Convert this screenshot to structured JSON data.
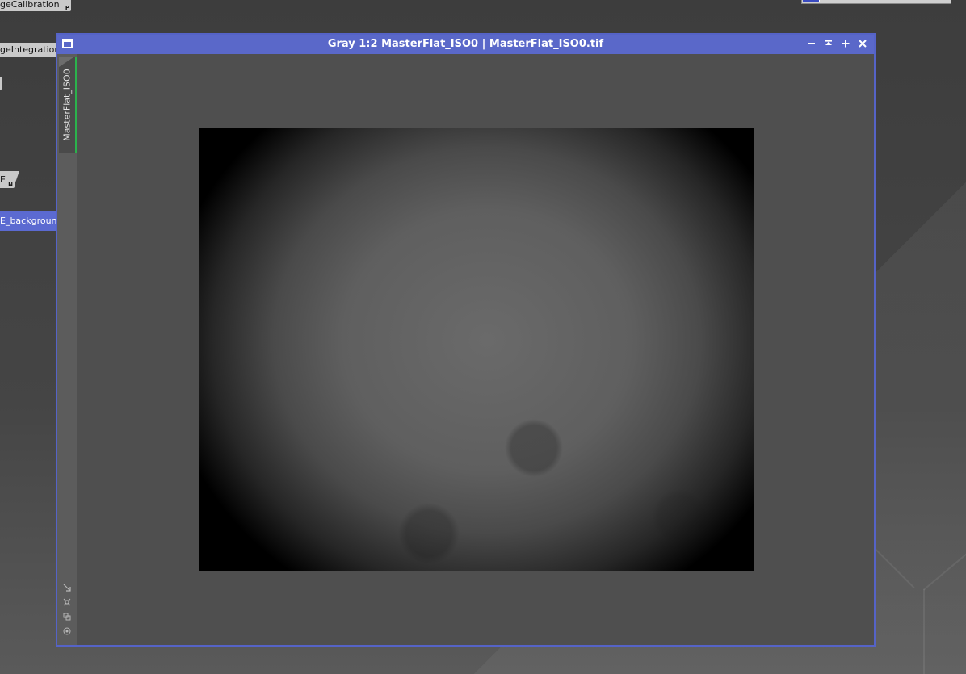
{
  "desktop": {
    "process_icons": [
      {
        "label": "geCalibration",
        "corner": "P"
      },
      {
        "label": "geIntegration",
        "corner": ""
      },
      {
        "label": "E",
        "corner": "N"
      },
      {
        "label": "E_background",
        "corner": "N"
      }
    ]
  },
  "window": {
    "title": "Gray 1:2 MasterFlat_ISO0 | MasterFlat_ISO0.tif",
    "view_tab_label": "MasterFlat_ISO0",
    "buttons": [
      "minimize",
      "shade",
      "maximize",
      "close"
    ]
  },
  "colors": {
    "title_bar": "#5a68c9",
    "active_tab_accent": "#2bb24c",
    "desktop_bg": "#3e3e3e"
  }
}
